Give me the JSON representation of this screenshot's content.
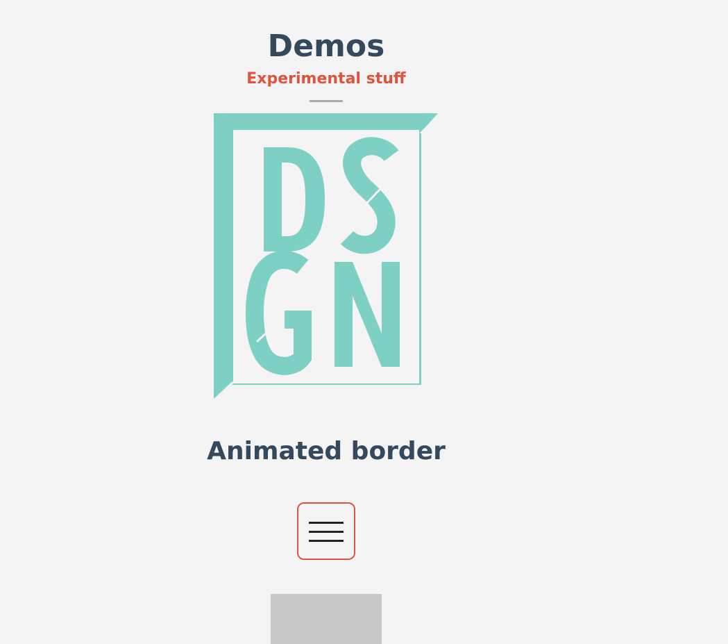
{
  "header": {
    "title": "Demos",
    "subtitle": "Experimental stuff"
  },
  "logo": {
    "lettering": "DSGN",
    "color": "#7ecfc4"
  },
  "demo": {
    "title": "Animated border",
    "menu_button_icon": "hamburger-menu-icon",
    "accent_color": "#e0533f"
  },
  "colors": {
    "background": "#f4f4f4",
    "heading": "#34495e",
    "accent": "#e0533f",
    "divider": "#aaaaaa",
    "placeholder": "#c8c8c8"
  }
}
